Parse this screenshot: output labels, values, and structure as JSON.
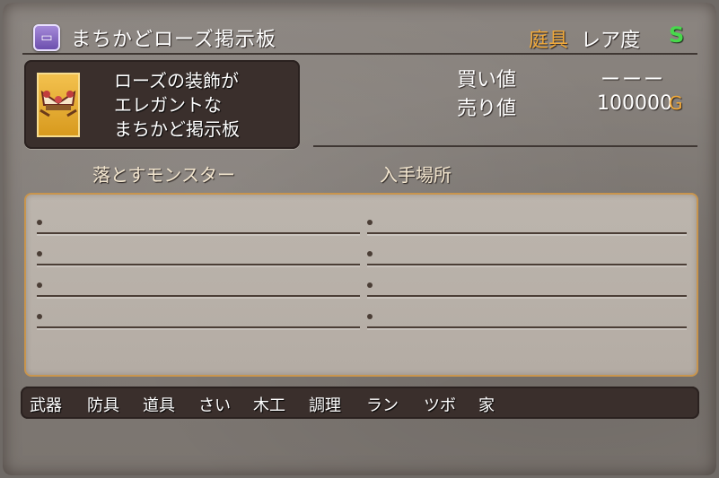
{
  "header": {
    "title": "まちかどローズ掲示板",
    "category": "庭具",
    "rarity_label": "レア度",
    "rarity_value": "S"
  },
  "item": {
    "description": [
      "ローズの装飾が",
      "エレガントな",
      "まちかど掲示板"
    ]
  },
  "prices": {
    "buy_label": "買い値",
    "buy_value": "ーーー",
    "sell_label": "売り値",
    "sell_value": "100000",
    "currency": "G"
  },
  "columns": {
    "monsters": "落とすモンスター",
    "locations": "入手場所"
  },
  "tabs": [
    "武器",
    "防具",
    "道具",
    "さい",
    "木工",
    "調理",
    "ラン",
    "ツボ",
    "家"
  ],
  "colors": {
    "category": "#f0a93a",
    "rarity": "#48d84c",
    "panel_border": "#c8954e"
  },
  "icons": {
    "title": "purple-furniture-icon",
    "item": "rose-signboard-icon"
  }
}
